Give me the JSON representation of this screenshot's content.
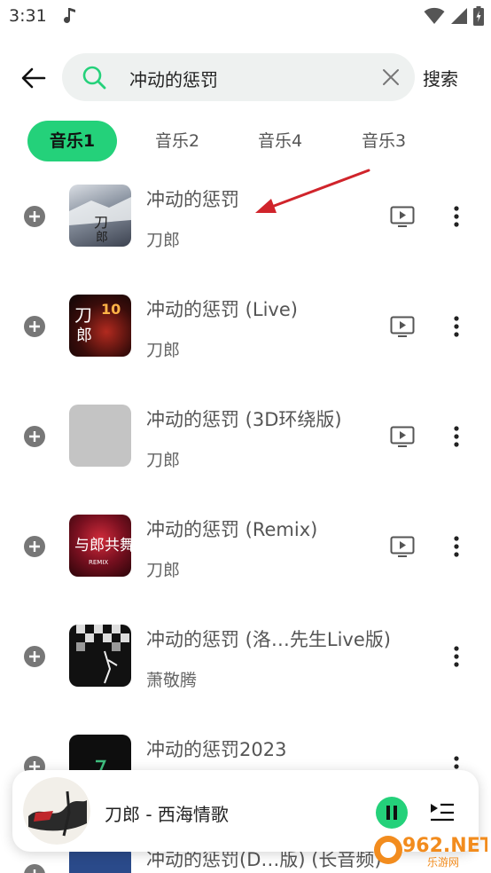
{
  "status_bar": {
    "time": "3:31",
    "icons": [
      "music-note-icon",
      "wifi-icon",
      "signal-icon",
      "battery-icon"
    ]
  },
  "search": {
    "query": "冲动的惩罚",
    "button_label": "搜索"
  },
  "tabs": [
    {
      "label": "音乐1",
      "active": true
    },
    {
      "label": "音乐2",
      "active": false
    },
    {
      "label": "音乐4",
      "active": false
    },
    {
      "label": "音乐3",
      "active": false
    }
  ],
  "results": [
    {
      "title": "冲动的惩罚",
      "artist": "刀郎",
      "has_mv": true
    },
    {
      "title": "冲动的惩罚 (Live)",
      "artist": "刀郎",
      "has_mv": true
    },
    {
      "title": "冲动的惩罚 (3D环绕版)",
      "artist": "刀郎",
      "has_mv": true
    },
    {
      "title": "冲动的惩罚 (Remix)",
      "artist": "刀郎",
      "has_mv": true
    },
    {
      "title": "冲动的惩罚 (洛…先生Live版)",
      "artist": "萧敬腾",
      "has_mv": false
    },
    {
      "title": "冲动的惩罚2023",
      "artist": "",
      "has_mv": false
    },
    {
      "title": "冲动的惩罚(D…版) (长音频)",
      "artist": "",
      "has_mv": false
    }
  ],
  "now_playing": {
    "title": "刀郎 - 西海情歌"
  },
  "watermark": {
    "text": "962.NET",
    "sub": "乐游网"
  },
  "colors": {
    "accent": "#24d17a",
    "search_bg": "#eef1f0",
    "annotation_arrow": "#d0242b"
  }
}
